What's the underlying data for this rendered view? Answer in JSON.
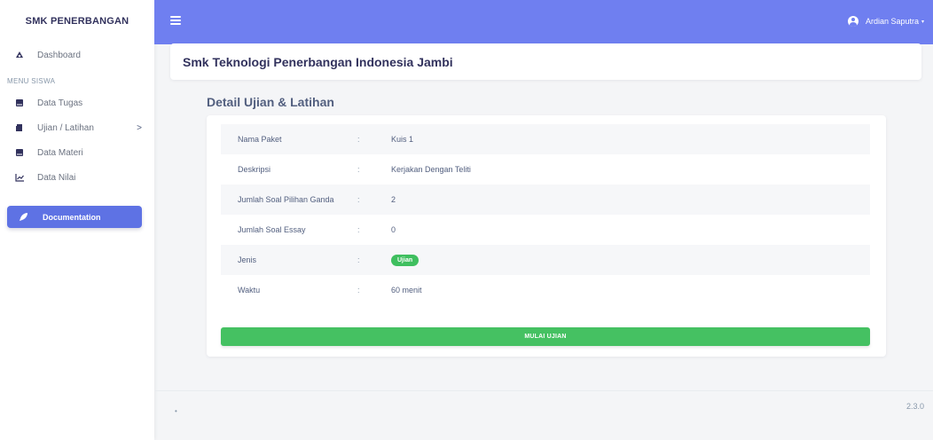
{
  "sidebar": {
    "brand": "SMK PENERBANGAN",
    "dashboard": {
      "label": "Dashboard",
      "icon": "dashboard-icon"
    },
    "section_label": "MENU SISWA",
    "items": [
      {
        "label": "Data Tugas",
        "icon": "book-icon"
      },
      {
        "label": "Ujian / Latihan",
        "icon": "document-icon",
        "chevron": ">"
      },
      {
        "label": "Data Materi",
        "icon": "book-icon"
      },
      {
        "label": "Data Nilai",
        "icon": "chart-icon"
      }
    ],
    "documentation": {
      "label": "Documentation",
      "icon": "rocket-icon"
    }
  },
  "topbar": {
    "user_name": "Ardian Saputra",
    "caret": "▾"
  },
  "header": {
    "title": "Smk Teknologi Penerbangan Indonesia Jambi"
  },
  "detail": {
    "title": "Detail Ujian & Latihan",
    "separator": ":",
    "rows": [
      {
        "label": "Nama Paket",
        "value": "Kuis 1"
      },
      {
        "label": "Deskripsi",
        "value": "Kerjakan Dengan Teliti"
      },
      {
        "label": "Jumlah Soal Pilihan Ganda",
        "value": "2"
      },
      {
        "label": "Jumlah Soal Essay",
        "value": "0"
      },
      {
        "label": "Jenis",
        "value": "Ujian"
      },
      {
        "label": "Waktu",
        "value": "60 menit"
      }
    ],
    "start_button": "MULAI UJIAN"
  },
  "footer": {
    "dot": "•",
    "version": "2.3.0"
  },
  "colors": {
    "topbar": "#6f7ff0",
    "accent": "#5e72e4",
    "success": "#45c162"
  }
}
